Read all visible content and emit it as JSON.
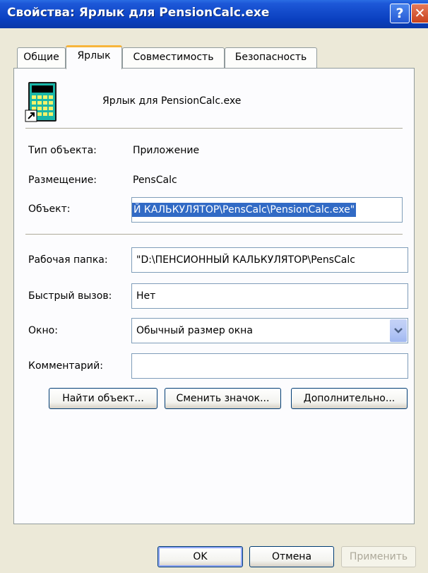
{
  "window": {
    "title": "Свойства: Ярлык для PensionCalc.exe",
    "help_glyph": "?",
    "close_glyph": "✕"
  },
  "tabs": [
    {
      "label": "Общие",
      "active": false
    },
    {
      "label": "Ярлык",
      "active": true
    },
    {
      "label": "Совместимость",
      "active": false
    },
    {
      "label": "Безопасность",
      "active": false
    }
  ],
  "header": {
    "icon": "calculator-shortcut-icon",
    "name": "Ярлык для PensionCalc.exe"
  },
  "info": {
    "type_label": "Тип объекта:",
    "type_value": "Приложение",
    "location_label": "Размещение:",
    "location_value": "PensCalc",
    "target_label": "Объект:",
    "target_value": "Й КАЛЬКУЛЯТОР\\PensCalc\\PensionCalc.exe\""
  },
  "fields": {
    "start_in_label": "Рабочая папка:",
    "start_in_value": "\"D:\\ПЕНСИОННЫЙ КАЛЬКУЛЯТОР\\PensCalc",
    "hotkey_label": "Быстрый вызов:",
    "hotkey_value": "Нет",
    "run_label": "Окно:",
    "run_value": "Обычный размер окна",
    "comment_label": "Комментарий:",
    "comment_value": ""
  },
  "buttons": {
    "find_target": "Найти объект...",
    "change_icon": "Сменить значок...",
    "advanced": "Дополнительно...",
    "ok": "OK",
    "cancel": "Отмена",
    "apply": "Применить"
  },
  "colors": {
    "titlebar": "#0A3FBF",
    "selection": "#316AC5",
    "tab_highlight": "#F7B53B"
  }
}
